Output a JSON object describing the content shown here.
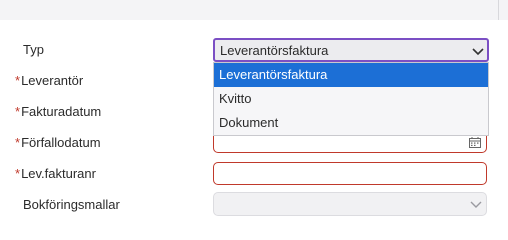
{
  "form": {
    "fields": [
      {
        "label": "Typ",
        "required": false
      },
      {
        "label": "Leverantör",
        "required": true
      },
      {
        "label": "Fakturadatum",
        "required": true
      },
      {
        "label": "Förfallodatum",
        "required": true
      },
      {
        "label": "Lev.fakturanr",
        "required": true
      },
      {
        "label": "Bokföringsmallar",
        "required": false
      }
    ],
    "required_marker": "*",
    "type_select": {
      "value": "Leverantörsfaktura",
      "options": [
        "Leverantörsfaktura",
        "Kvitto",
        "Dokument"
      ],
      "selected_index": 0
    }
  },
  "colors": {
    "required_star": "#c0392b",
    "error_border": "#c0392b",
    "focus_border": "#7b4fc4",
    "option_highlight": "#1c6fd6"
  },
  "icons": {
    "select_chevron": "chevron-down-icon",
    "date_picker": "calendar-icon"
  }
}
